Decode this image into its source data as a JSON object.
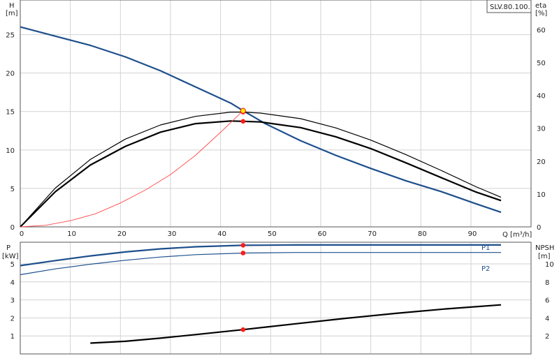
{
  "colors": {
    "head_curve": "#1d4f8c",
    "p1_curve": "#1d4f8c",
    "p2_curve": "#1d4f8c",
    "eta_curve": "#000000",
    "system_curve": "#ff4a4a",
    "duty_point": "#ff1a1a",
    "duty_point_highlight": "#ffe600"
  },
  "top_panel": {
    "pump_label": "SLV.80.100.",
    "left_axis_symbol": "H",
    "left_axis_unit": "[m]",
    "right_axis_symbol": "eta",
    "right_axis_unit": "[%]",
    "x_axis_label": "Q [m³/h]"
  },
  "bottom_panel": {
    "left_axis_symbol": "P",
    "left_axis_unit": "[kW]",
    "right_axis_symbol": "NPSH",
    "right_axis_unit": "[m]",
    "p1_label": "P1",
    "p2_label": "P2"
  },
  "chart_data": [
    {
      "type": "line",
      "title": "",
      "xlabel": "Q [m³/h]",
      "ylabel": "H [m]",
      "y2label": "eta [%]",
      "xlim": [
        0,
        102
      ],
      "ylim": [
        0,
        29.5
      ],
      "y2lim": [
        0,
        69
      ],
      "xticks": [
        0,
        10,
        20,
        30,
        40,
        50,
        60,
        70,
        80,
        90
      ],
      "yticks": [
        0,
        5,
        10,
        15,
        20,
        25
      ],
      "y2ticks": [
        0,
        10,
        20,
        30,
        40,
        50,
        60
      ],
      "grid": true,
      "series": [
        {
          "axis": "H",
          "x": [
            0,
            7,
            14,
            21,
            28,
            35,
            42,
            44.5,
            49,
            56,
            63,
            70,
            77,
            84,
            91,
            96
          ],
          "values": [
            26,
            24.8,
            23.6,
            22.1,
            20.3,
            18.2,
            16.1,
            15.1,
            13.4,
            11.2,
            9.3,
            7.6,
            6.0,
            4.6,
            3.0,
            1.9
          ]
        },
        {
          "axis": "eta",
          "x": [
            0,
            7,
            14,
            21,
            28,
            35,
            42,
            44.5,
            48,
            56,
            63,
            70,
            77,
            84,
            91,
            96
          ],
          "values": [
            0,
            11.8,
            20.5,
            26.7,
            31,
            33.6,
            34.9,
            34.9,
            34.6,
            32.9,
            30.1,
            26.4,
            22.0,
            17.2,
            12.2,
            9.0
          ]
        },
        {
          "axis": "eta",
          "x": [
            0,
            7,
            14,
            21,
            28,
            35,
            42,
            44.5,
            48,
            56,
            63,
            70,
            77,
            84,
            91,
            96
          ],
          "values": [
            0,
            10.7,
            18.8,
            24.5,
            28.8,
            31.4,
            32.2,
            32.1,
            31.9,
            30.2,
            27.4,
            23.8,
            19.5,
            15.0,
            10.6,
            8.0
          ]
        },
        {
          "axis": "H",
          "x": [
            0,
            5,
            10,
            15,
            20,
            25,
            30,
            35,
            40,
            44.5
          ],
          "values": [
            0,
            0.2,
            0.8,
            1.7,
            3.1,
            4.8,
            6.8,
            9.3,
            12.3,
            15.1
          ]
        }
      ],
      "duty_point": {
        "Q": 44.5,
        "H": 15.1,
        "eta": [
          34.9,
          32.1
        ]
      }
    },
    {
      "type": "line",
      "title": "",
      "xlabel": "",
      "ylabel": "P [kW]",
      "y2label": "NPSH [m]",
      "xlim": [
        0,
        102
      ],
      "ylim": [
        0,
        6.2
      ],
      "y2lim": [
        0,
        12.4
      ],
      "yticks": [
        1,
        2,
        3,
        4,
        5
      ],
      "y2ticks": [
        2,
        4,
        6,
        8,
        10
      ],
      "grid": true,
      "series": [
        {
          "name": "P1",
          "axis": "P",
          "x": [
            0,
            7,
            14,
            21,
            28,
            35,
            44.5,
            55,
            65,
            75,
            85,
            96
          ],
          "values": [
            4.9,
            5.18,
            5.44,
            5.66,
            5.83,
            5.95,
            6.03,
            6.05,
            6.05,
            6.05,
            6.05,
            6.05
          ]
        },
        {
          "name": "P2",
          "axis": "P",
          "x": [
            0,
            7,
            14,
            21,
            28,
            35,
            44.5,
            55,
            65,
            75,
            85,
            96
          ],
          "values": [
            4.4,
            4.72,
            4.98,
            5.2,
            5.38,
            5.51,
            5.6,
            5.63,
            5.63,
            5.63,
            5.63,
            5.63
          ]
        },
        {
          "axis": "NPSH",
          "x": [
            14,
            21,
            28,
            35,
            44.5,
            55,
            65,
            75,
            85,
            96
          ],
          "values": [
            1.2,
            1.4,
            1.75,
            2.15,
            2.7,
            3.35,
            3.95,
            4.5,
            5.0,
            5.45
          ]
        }
      ],
      "duty_point": {
        "Q": 44.5,
        "P1": 6.03,
        "P2": 5.6,
        "NPSH": 2.7
      }
    }
  ]
}
